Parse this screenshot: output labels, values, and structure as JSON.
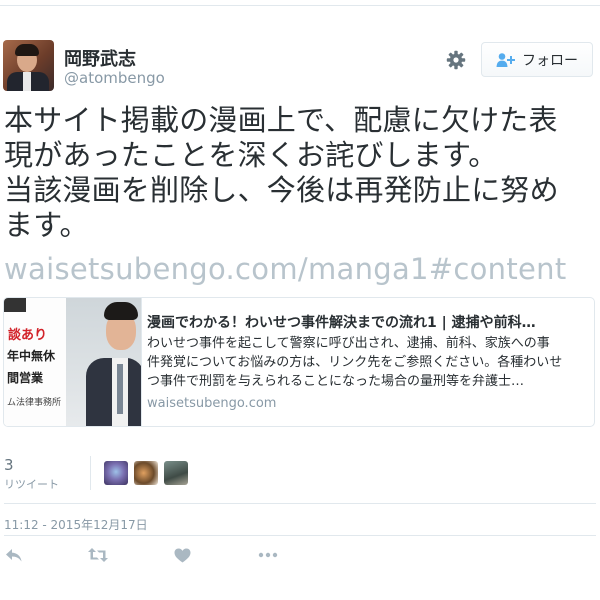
{
  "user": {
    "display_name": "岡野武志",
    "handle": "@atombengo"
  },
  "header": {
    "settings_icon": "gear-icon",
    "follow_label": "フォロー",
    "follow_icon": "add-user-icon"
  },
  "tweet": {
    "lines": [
      "本サイト掲載の漫画上で、配慮に欠けた表",
      "現があったことを深くお詫びします。",
      "当該漫画を削除し、今後は再発防止に努め",
      "ます。"
    ],
    "link": "waisetsubengo.com/manga1#content"
  },
  "card": {
    "thumbnail": {
      "line1": "談あり",
      "line2": "年中無休",
      "line3": "間営業",
      "line4": "ム法律事務所"
    },
    "title": "漫画でわかる！わいせつ事件解決までの流れ1 | 逮捕や前科…",
    "description_lines": [
      "わいせつ事件を起こして警察に呼び出され、逮捕、前科、家族への事",
      "件発覚についてお悩みの方は、リンク先をご参照ください。各種わいせ",
      "つ事件で刑罰を与えられることになった場合の量刑等を弁護士…"
    ],
    "domain": "waisetsubengo.com"
  },
  "stats": {
    "retweet_count": "3",
    "retweet_label": "リツイート"
  },
  "timestamp": "11:12 - 2015年12月17日",
  "actions": {
    "reply_icon": "reply-icon",
    "retweet_icon": "retweet-icon",
    "like_icon": "heart-icon",
    "more_icon": "more-icon"
  },
  "colors": {
    "text": "#292f33",
    "secondary": "#8899a6",
    "link_faded": "#b8c4cc",
    "border": "#e1e8ed",
    "icon": "#aab8c2"
  }
}
